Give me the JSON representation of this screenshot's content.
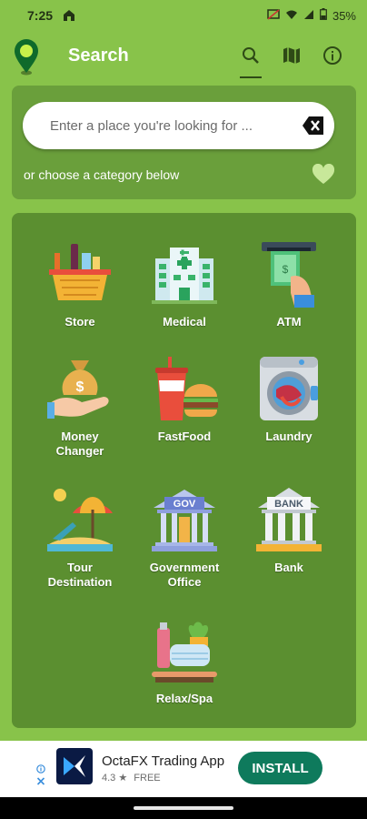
{
  "status_bar": {
    "time": "7:25",
    "battery": "35%"
  },
  "toolbar": {
    "title": "Search",
    "icons": [
      "search-icon",
      "map-icon",
      "info-icon"
    ]
  },
  "search": {
    "placeholder": "Enter a place you're looking for ...",
    "category_hint": "or choose a category below"
  },
  "categories": [
    {
      "label": "Store",
      "icon": "store-basket-icon"
    },
    {
      "label": "Medical",
      "icon": "hospital-icon"
    },
    {
      "label": "ATM",
      "icon": "atm-icon"
    },
    {
      "label": "Money\nChanger",
      "icon": "money-bag-icon"
    },
    {
      "label": "FastFood",
      "icon": "fastfood-icon"
    },
    {
      "label": "Laundry",
      "icon": "washing-machine-icon"
    },
    {
      "label": "Tour\nDestination",
      "icon": "beach-umbrella-icon"
    },
    {
      "label": "Government\nOffice",
      "icon": "government-building-icon"
    },
    {
      "label": "Bank",
      "icon": "bank-building-icon"
    },
    {
      "label": "Relax/Spa",
      "icon": "spa-icon"
    }
  ],
  "ad": {
    "title": "OctaFX Trading App",
    "rating": "4.3",
    "price": "FREE",
    "install_label": "INSTALL"
  },
  "colors": {
    "background": "#88c34a",
    "panel_light": "#6a9f3b",
    "panel_dark": "#5b8f30",
    "install_button": "#0e7a5c"
  }
}
